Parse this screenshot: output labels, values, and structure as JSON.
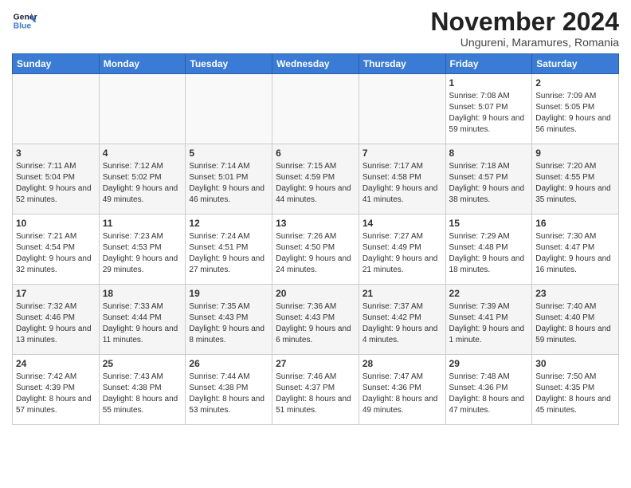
{
  "logo": {
    "line1": "General",
    "line2": "Blue"
  },
  "header": {
    "month": "November 2024",
    "location": "Ungureni, Maramures, Romania"
  },
  "weekdays": [
    "Sunday",
    "Monday",
    "Tuesday",
    "Wednesday",
    "Thursday",
    "Friday",
    "Saturday"
  ],
  "weeks": [
    [
      {
        "day": "",
        "info": ""
      },
      {
        "day": "",
        "info": ""
      },
      {
        "day": "",
        "info": ""
      },
      {
        "day": "",
        "info": ""
      },
      {
        "day": "",
        "info": ""
      },
      {
        "day": "1",
        "info": "Sunrise: 7:08 AM\nSunset: 5:07 PM\nDaylight: 9 hours and 59 minutes."
      },
      {
        "day": "2",
        "info": "Sunrise: 7:09 AM\nSunset: 5:05 PM\nDaylight: 9 hours and 56 minutes."
      }
    ],
    [
      {
        "day": "3",
        "info": "Sunrise: 7:11 AM\nSunset: 5:04 PM\nDaylight: 9 hours and 52 minutes."
      },
      {
        "day": "4",
        "info": "Sunrise: 7:12 AM\nSunset: 5:02 PM\nDaylight: 9 hours and 49 minutes."
      },
      {
        "day": "5",
        "info": "Sunrise: 7:14 AM\nSunset: 5:01 PM\nDaylight: 9 hours and 46 minutes."
      },
      {
        "day": "6",
        "info": "Sunrise: 7:15 AM\nSunset: 4:59 PM\nDaylight: 9 hours and 44 minutes."
      },
      {
        "day": "7",
        "info": "Sunrise: 7:17 AM\nSunset: 4:58 PM\nDaylight: 9 hours and 41 minutes."
      },
      {
        "day": "8",
        "info": "Sunrise: 7:18 AM\nSunset: 4:57 PM\nDaylight: 9 hours and 38 minutes."
      },
      {
        "day": "9",
        "info": "Sunrise: 7:20 AM\nSunset: 4:55 PM\nDaylight: 9 hours and 35 minutes."
      }
    ],
    [
      {
        "day": "10",
        "info": "Sunrise: 7:21 AM\nSunset: 4:54 PM\nDaylight: 9 hours and 32 minutes."
      },
      {
        "day": "11",
        "info": "Sunrise: 7:23 AM\nSunset: 4:53 PM\nDaylight: 9 hours and 29 minutes."
      },
      {
        "day": "12",
        "info": "Sunrise: 7:24 AM\nSunset: 4:51 PM\nDaylight: 9 hours and 27 minutes."
      },
      {
        "day": "13",
        "info": "Sunrise: 7:26 AM\nSunset: 4:50 PM\nDaylight: 9 hours and 24 minutes."
      },
      {
        "day": "14",
        "info": "Sunrise: 7:27 AM\nSunset: 4:49 PM\nDaylight: 9 hours and 21 minutes."
      },
      {
        "day": "15",
        "info": "Sunrise: 7:29 AM\nSunset: 4:48 PM\nDaylight: 9 hours and 18 minutes."
      },
      {
        "day": "16",
        "info": "Sunrise: 7:30 AM\nSunset: 4:47 PM\nDaylight: 9 hours and 16 minutes."
      }
    ],
    [
      {
        "day": "17",
        "info": "Sunrise: 7:32 AM\nSunset: 4:46 PM\nDaylight: 9 hours and 13 minutes."
      },
      {
        "day": "18",
        "info": "Sunrise: 7:33 AM\nSunset: 4:44 PM\nDaylight: 9 hours and 11 minutes."
      },
      {
        "day": "19",
        "info": "Sunrise: 7:35 AM\nSunset: 4:43 PM\nDaylight: 9 hours and 8 minutes."
      },
      {
        "day": "20",
        "info": "Sunrise: 7:36 AM\nSunset: 4:43 PM\nDaylight: 9 hours and 6 minutes."
      },
      {
        "day": "21",
        "info": "Sunrise: 7:37 AM\nSunset: 4:42 PM\nDaylight: 9 hours and 4 minutes."
      },
      {
        "day": "22",
        "info": "Sunrise: 7:39 AM\nSunset: 4:41 PM\nDaylight: 9 hours and 1 minute."
      },
      {
        "day": "23",
        "info": "Sunrise: 7:40 AM\nSunset: 4:40 PM\nDaylight: 8 hours and 59 minutes."
      }
    ],
    [
      {
        "day": "24",
        "info": "Sunrise: 7:42 AM\nSunset: 4:39 PM\nDaylight: 8 hours and 57 minutes."
      },
      {
        "day": "25",
        "info": "Sunrise: 7:43 AM\nSunset: 4:38 PM\nDaylight: 8 hours and 55 minutes."
      },
      {
        "day": "26",
        "info": "Sunrise: 7:44 AM\nSunset: 4:38 PM\nDaylight: 8 hours and 53 minutes."
      },
      {
        "day": "27",
        "info": "Sunrise: 7:46 AM\nSunset: 4:37 PM\nDaylight: 8 hours and 51 minutes."
      },
      {
        "day": "28",
        "info": "Sunrise: 7:47 AM\nSunset: 4:36 PM\nDaylight: 8 hours and 49 minutes."
      },
      {
        "day": "29",
        "info": "Sunrise: 7:48 AM\nSunset: 4:36 PM\nDaylight: 8 hours and 47 minutes."
      },
      {
        "day": "30",
        "info": "Sunrise: 7:50 AM\nSunset: 4:35 PM\nDaylight: 8 hours and 45 minutes."
      }
    ]
  ]
}
